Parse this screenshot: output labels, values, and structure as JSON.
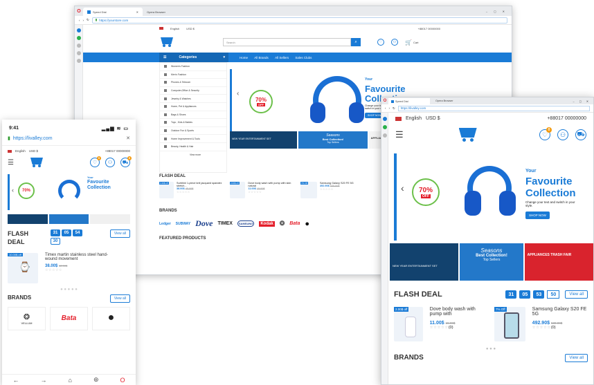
{
  "desktop": {
    "tabs": [
      "Speed Dial",
      "Opera Browser"
    ],
    "url": "https://yourstore.com",
    "top_lang": "English",
    "top_currency": "USD $",
    "top_phone": "+88017 00000000",
    "search_placeholder": "Search",
    "account_label": "Account",
    "cart_label": "Cart",
    "categories_label": "Categories",
    "nav_links": [
      "Home",
      "All Brands",
      "All Sellers",
      "Sales Clubs"
    ],
    "categories": [
      "Women's Fashion",
      "Men's Fashion",
      "Phones & Telecom",
      "Computer,Office & Security",
      "Jewelry & Watches",
      "Home, Pet & Appliances",
      "Bags & Shoes",
      "Toys , Kids & Babies",
      "Outdoor Fun & Sports",
      "Home Improvement & Tools",
      "Beauty, Health & Hair"
    ],
    "view_more": "View more",
    "hero": {
      "your": "Your",
      "title1": "Favourite",
      "title2": "Collection",
      "sub": "Change your text and switch in your style.",
      "shop": "SHOP NOW",
      "pct": "70%",
      "off": "OFF"
    },
    "promos": {
      "p1": "NEW YEAR ENTERTAINMENT SET",
      "p2_title": "Seasons",
      "p2_sub": "Best Collection!",
      "p2_sub2": "Top Sellers",
      "p3": "APPLIANCES TRASH FAIR"
    },
    "flash_title": "FLASH DEAL",
    "flash_products": [
      {
        "name": "Surbhini 1-piece knit jacquard spandex stretch...",
        "price": "38.00$",
        "old": "45.00$",
        "tag": "1.00$ off"
      },
      {
        "name": "Dove body wash with pump with skin natural",
        "price": "11.00$",
        "old": "15.00$",
        "tag": "2.00$ off"
      },
      {
        "name": "Samsung Galaxy S20 FE 5G",
        "price": "492.90$",
        "old": "530.00$",
        "tag": "7% Off"
      }
    ],
    "brands_title": "BRANDS",
    "brands": [
      "Ledger",
      "SUBWAY",
      "Dove",
      "TIMEX",
      "SAMSUNG",
      "Kodak",
      "",
      "Bata",
      ""
    ],
    "featured_title": "FEATURED PRODUCTS"
  },
  "mobile": {
    "time": "9:41",
    "url": "https://livalley.com",
    "lang": "English",
    "currency": "USD $",
    "phone": "+88017 00000000",
    "hero_your": "Your",
    "hero_title1": "Favourite",
    "hero_title2": "Collection",
    "pct": "70%",
    "flash_title1": "FLASH",
    "flash_title2": "DEAL",
    "countdown": [
      "31",
      "05",
      "54",
      "30"
    ],
    "view_all": "View all",
    "product": {
      "tag": "10.00$ off",
      "name": "Timex martin stainless steel hand-wound movement",
      "price": "38.00$",
      "old": "48.00$"
    },
    "brands_title": "BRANDS",
    "brand_vellum": "VELLUM",
    "brand_bata": "Bata",
    "badge": "0"
  },
  "tablet": {
    "tabs": [
      "Speed Dial",
      "Opera Browser"
    ],
    "url": "https://livalley.com",
    "lang": "English",
    "currency": "USD $",
    "phone": "+88017 00000000",
    "hero": {
      "your": "Your",
      "title1": "Favourite",
      "title2": "Collection",
      "sub": "Change your text and switch in your style.",
      "shop": "SHOP NOW",
      "pct": "70%",
      "off": "OFF"
    },
    "promos": {
      "p1": "NEW YEAR ENTERTAINMENT SET",
      "p2_title": "Seasons",
      "p2_sub": "Best Collection!",
      "p2_sub2": "Top Sellers",
      "p3": "APPLIANCES TRASH FAIR"
    },
    "flash_title": "FLASH DEAL",
    "countdown": [
      "31",
      "05",
      "53",
      "50"
    ],
    "view_all": "View all",
    "products": [
      {
        "tag": "2.00$ off",
        "name": "Dove body wash with pump with",
        "price": "11.00$",
        "old": "15.00$",
        "rating": "(0)"
      },
      {
        "tag": "7% Off",
        "name": "Samsung Galaxy S20 FE 5G",
        "price": "492.90$",
        "old": "530.00$",
        "rating": "(0)"
      }
    ],
    "brands_title": "BRANDS",
    "badge": "0"
  },
  "colors": {
    "primary": "#1a7bd6",
    "accent": "#f39b11",
    "sale": "#e41f2b"
  }
}
